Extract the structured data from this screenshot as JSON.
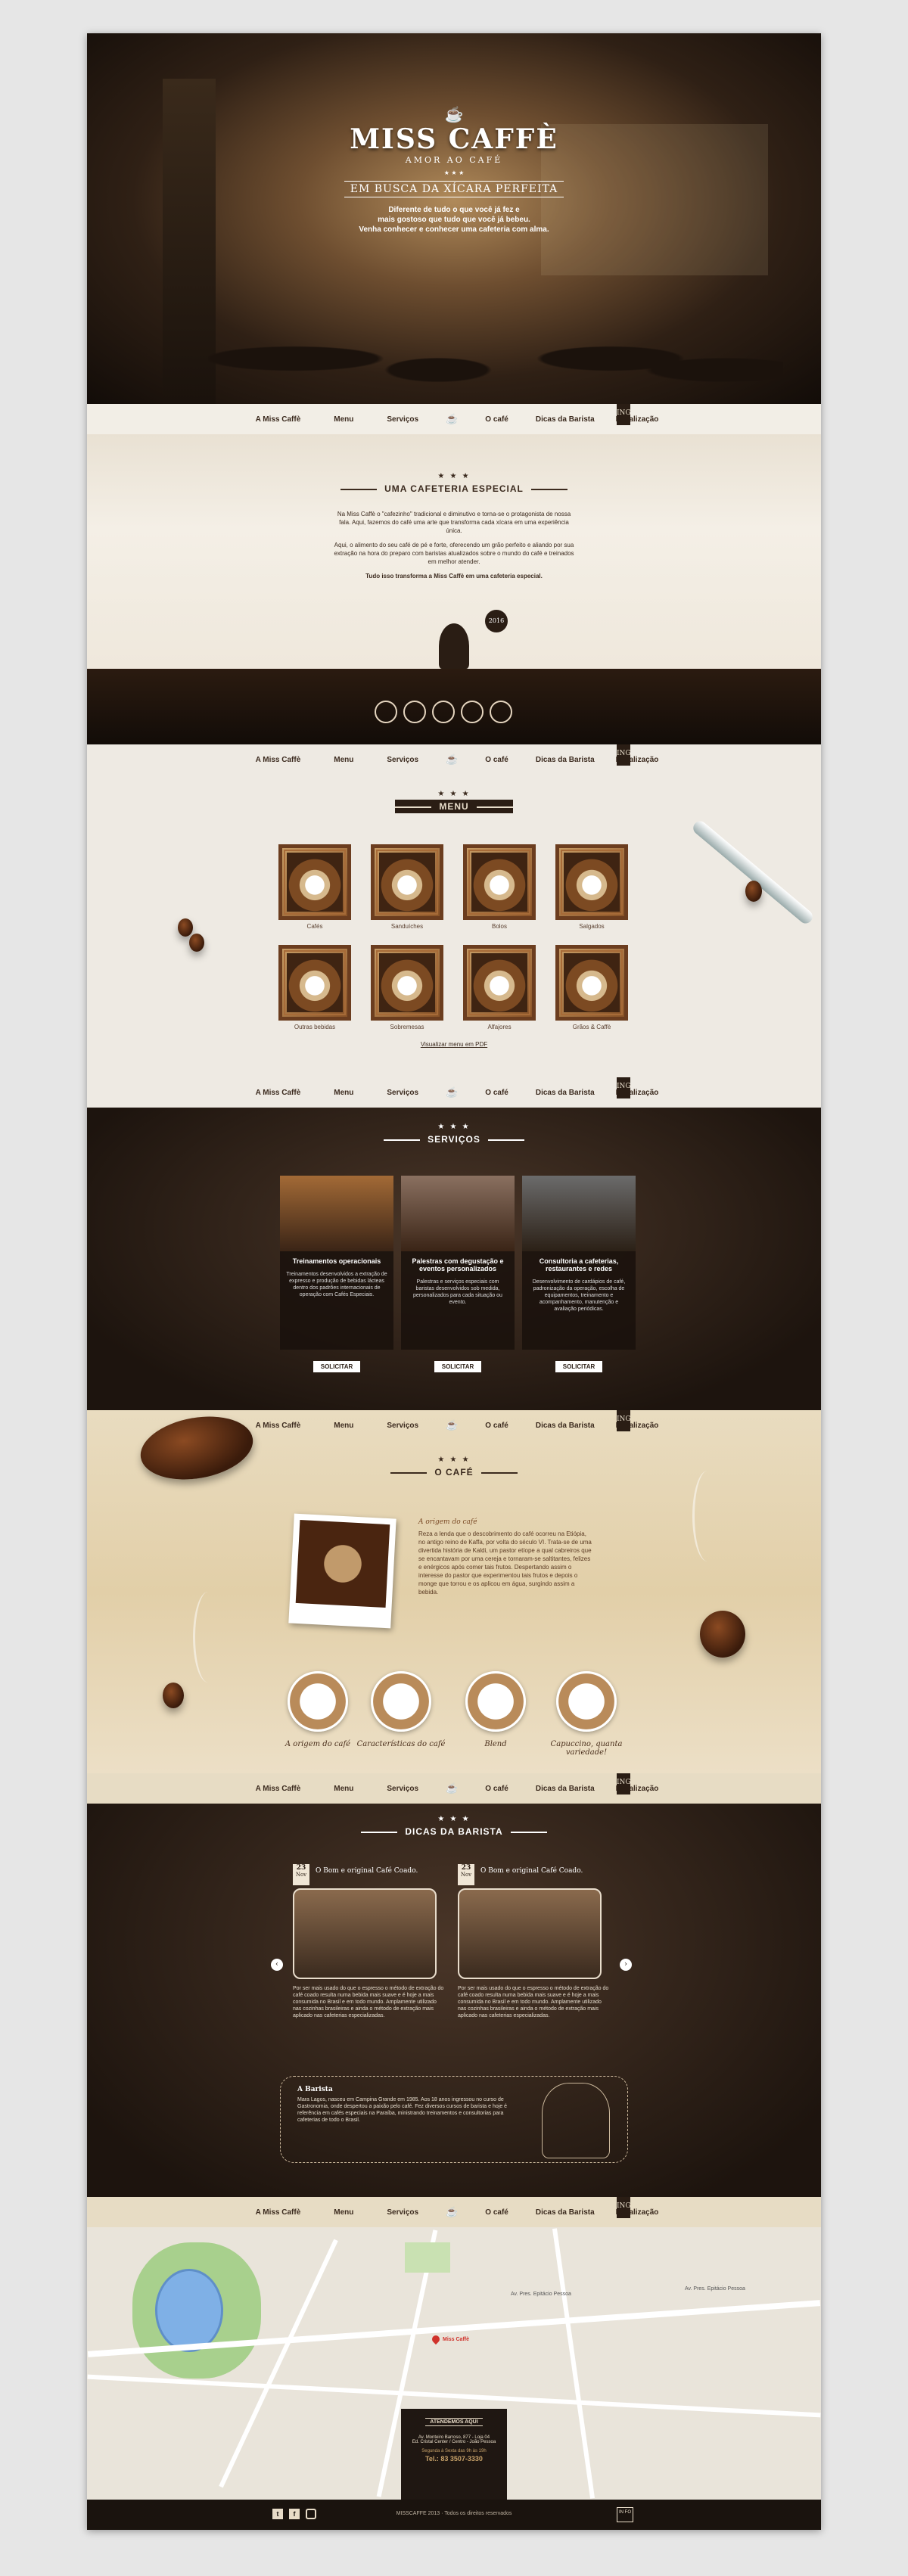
{
  "hero": {
    "brand": "MISS CAFFÈ",
    "tagline": "AMOR AO CAFÉ",
    "sub": "EM BUSCA DA XÍCARA PERFEITA",
    "stars": "★ ★ ★",
    "lines": [
      "Diferente de tudo o que você já fez e",
      "mais gostoso que tudo que você já bebeu.",
      "Venha conhecer e conhecer uma cafeteria com alma."
    ]
  },
  "nav": {
    "items": [
      "A Miss Caffè",
      "Menu",
      "Serviços",
      "O café",
      "Dicas da Barista",
      "Localização"
    ],
    "icon": "☕",
    "flag": "ING"
  },
  "sobre": {
    "title": "UMA CAFETERIA ESPECIAL",
    "stars": "★ ★ ★",
    "p1": "Na Miss Caffè o \"cafezinho\" tradicional e diminutivo e torna-se o protagonista de nossa fala. Aqui, fazemos do café uma arte que transforma cada xícara em uma experiência única.",
    "p2": "Aqui, o alimento do seu café de pé e forte, oferecendo um grão perfeito e aliando por sua extração na hora do preparo com baristas atualizados sobre o mundo do café e treinados em melhor atender.",
    "p3": "Tudo isso transforma a Miss Caffè em uma cafeteria especial.",
    "badge": "2016"
  },
  "menu": {
    "title": "MENU",
    "stars": "★ ★ ★",
    "items": [
      "Cafés",
      "Sanduíches",
      "Bolos",
      "Salgados",
      "Outras bebidas",
      "Sobremesas",
      "Alfajores",
      "Grãos & Caffè"
    ],
    "pdf": "Visualizar menu em PDF"
  },
  "servicos": {
    "title": "SERVIÇOS",
    "stars": "★ ★ ★",
    "cards": [
      {
        "title": "Treinamentos operacionais",
        "text": "Treinamentos desenvolvidos a extração de expresso e produção de bebidas lácteas dentro dos padrões internacionais de operação com Cafés Especiais.",
        "btn": "SOLICITAR"
      },
      {
        "title": "Palestras com degustação e eventos personalizados",
        "text": "Palestras e serviços especiais com baristas desenvolvidos sob medida, personalizados para cada situação ou evento.",
        "btn": "SOLICITAR"
      },
      {
        "title": "Consultoria a cafeterias, restaurantes e redes",
        "text": "Desenvolvimento de cardápios de café, padronização da operação, escolha de equipamentos, treinamento e acompanhamento, manutenção e avaliação periódicas.",
        "btn": "SOLICITAR"
      }
    ]
  },
  "cafe": {
    "title": "O CAFÉ",
    "stars": "★ ★ ★",
    "heading": "A origem do café",
    "text": "Reza a lenda que o descobrimento do café ocorreu na Etiópia, no antigo reino de Kaffa, por volta do século VI. Trata-se de uma divertida história de Kaldi, um pastor etíope a qual cabreiros que se encantavam por uma cereja e tornaram-se saltitantes, felizes e enérgicos após comer tais frutos. Despertando assim o interesse do pastor que experimentou tais frutos e depois o monge que torrou e os aplicou em água, surgindo assim a bebida.",
    "items": [
      "A origem do café",
      "Características do café",
      "Blend",
      "Capuccino, quanta variedade!"
    ]
  },
  "dicas": {
    "title": "DICAS DA BARISTA",
    "stars": "★ ★ ★",
    "posts": [
      {
        "day": "23",
        "mon": "Nov",
        "title": "O Bom e original Café Coado.",
        "text": "Por ser mais usado do que o espresso o método de extração do café coado resulta numa bebida mais suave e é hoje a mais consumida no Brasil e em todo mundo. Amplamente utilizado nas cozinhas brasileiras e ainda o método de extração mais aplicado nas cafeterias especializadas."
      },
      {
        "day": "23",
        "mon": "Nov",
        "title": "O Bom e original Café Coado.",
        "text": "Por ser mais usado do que o espresso o método de extração do café coado resulta numa bebida mais suave e é hoje a mais consumida no Brasil e em todo mundo. Amplamente utilizado nas cozinhas brasileiras e ainda o método de extração mais aplicado nas cafeterias especializadas."
      }
    ],
    "barista_title": "A Barista",
    "barista_text": "Mara Lagos, nasceu em Campina Grande em 1985. Aos 18 anos ingressou no curso de Gastronomia, onde despertou a paixão pelo café. Fez diversos cursos de barista e hoje é referência em cafés especiais na Paraíba, ministrando treinamentos e consultorias para cafeterias de todo o Brasil."
  },
  "map": {
    "labels": [
      "Av. Pres. Epitácio Pessoa",
      "Av. Pres. Epitácio Pessoa",
      "Miss Caffè"
    ]
  },
  "contato": {
    "title": "ATENDEMOS AQUI",
    "addr1": "Av. Monteiro Barroso, 877 - Loja 04",
    "addr2": "Ed. Cristal Center / Centro - João Pessoa",
    "hours": "Segunda à Sexta das 9h às 19h",
    "tel": "Tel.: 83 3507-3330"
  },
  "footer": {
    "social": [
      "twitter-icon",
      "facebook-icon",
      "instagram-icon"
    ],
    "copy": "MISSCAFFE 2013 · Todos os direitos reservados",
    "logo": "IN FO"
  }
}
